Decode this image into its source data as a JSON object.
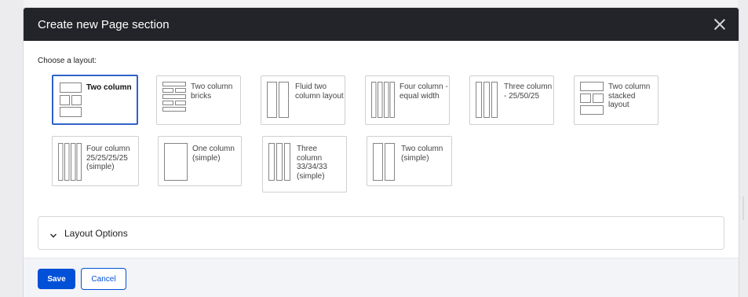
{
  "dialog": {
    "title": "Create new Page section",
    "close_icon": "close-icon",
    "choose_label": "Choose a layout:",
    "layouts": [
      {
        "label": "Two column",
        "selected": true,
        "icon": "two-column-icon"
      },
      {
        "label": "Two column bricks",
        "selected": false,
        "icon": "two-column-bricks-icon"
      },
      {
        "label": "Fluid two column layout",
        "selected": false,
        "icon": "fluid-two-column-icon"
      },
      {
        "label": "Four column - equal width",
        "selected": false,
        "icon": "four-column-equal-icon"
      },
      {
        "label": "Three column - 25/50/25",
        "selected": false,
        "icon": "three-column-25-50-25-icon"
      },
      {
        "label": "Two column stacked layout",
        "selected": false,
        "icon": "two-column-stacked-icon"
      },
      {
        "label": "Four column 25/25/25/25 (simple)",
        "selected": false,
        "icon": "four-column-simple-icon"
      },
      {
        "label": "One column (simple)",
        "selected": false,
        "icon": "one-column-simple-icon"
      },
      {
        "label": "Three column 33/34/33 (simple)",
        "selected": false,
        "icon": "three-column-simple-icon"
      },
      {
        "label": "Two column (simple)",
        "selected": false,
        "icon": "two-column-simple-icon"
      }
    ],
    "accordion": {
      "label": "Layout Options",
      "expanded": false,
      "icon": "chevron-down-icon"
    },
    "buttons": {
      "save": "Save",
      "cancel": "Cancel"
    }
  },
  "colors": {
    "titlebar": "#232429",
    "accent": "#0050d8",
    "selected_border": "#2f63c8"
  }
}
